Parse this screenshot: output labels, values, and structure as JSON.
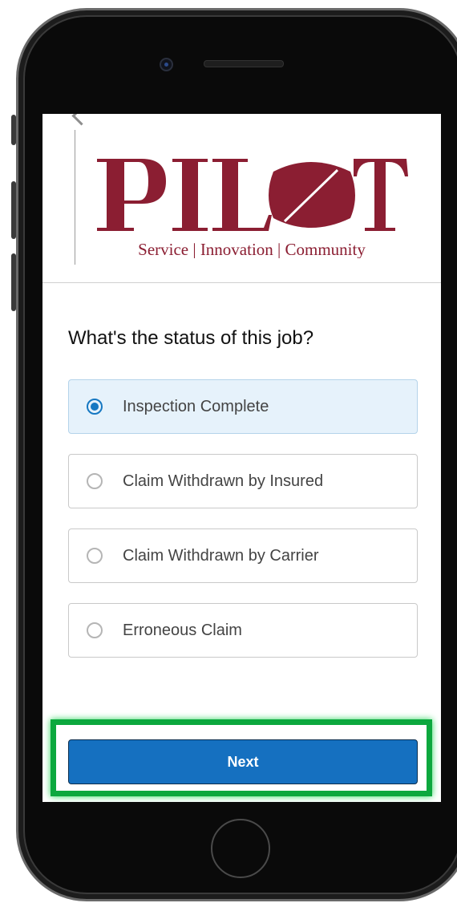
{
  "logo": {
    "wordmark": "PILOT",
    "tagline": "Service | Innovation | Community",
    "color": "#8b1e32"
  },
  "question": "What's the status of this job?",
  "options": [
    {
      "label": "Inspection Complete",
      "selected": true
    },
    {
      "label": "Claim Withdrawn by Insured",
      "selected": false
    },
    {
      "label": "Claim Withdrawn by Carrier",
      "selected": false
    },
    {
      "label": "Erroneous Claim",
      "selected": false
    }
  ],
  "next_label": "Next",
  "colors": {
    "accent": "#1570c0",
    "highlight": "#0ca83e",
    "selected_bg": "#e6f2fb"
  }
}
